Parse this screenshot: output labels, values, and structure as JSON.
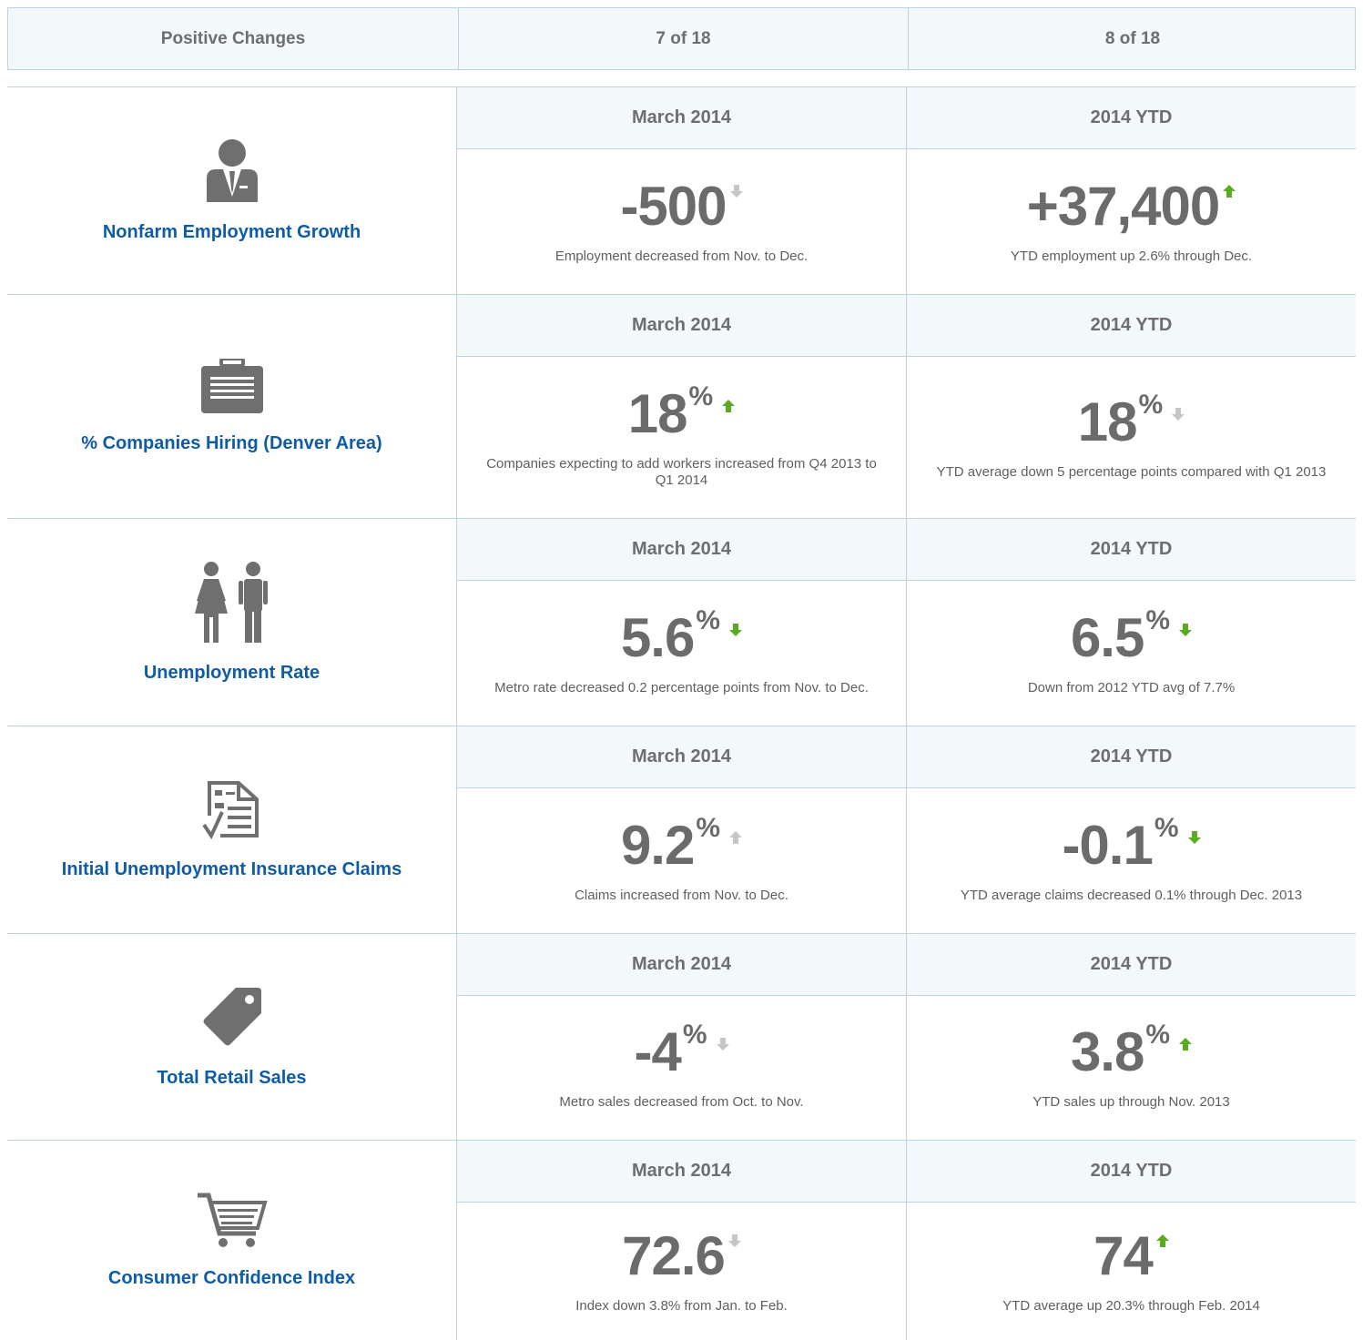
{
  "summary": {
    "label": "Positive Changes",
    "col1": "7 of 18",
    "col2": "8 of 18"
  },
  "colors": {
    "accent_blue": "#0f5ca5",
    "arrow_green": "#5aab22",
    "arrow_gray": "#c6c6c6",
    "border": "#bdd3e2",
    "header_bg": "#f3f8fb"
  },
  "metrics": [
    {
      "title": "Nonfarm Employment Growth",
      "icon": "businessman-icon",
      "col1": {
        "head": "March 2014",
        "value": "-500",
        "unit": "",
        "trend": "down",
        "arrow_color": "gray",
        "desc": "Employment decreased from Nov. to Dec."
      },
      "col2": {
        "head": "2014 YTD",
        "value": "+37,400",
        "unit": "",
        "trend": "up",
        "arrow_color": "green",
        "desc": "YTD employment up 2.6% through Dec."
      }
    },
    {
      "title": "% Companies Hiring (Denver Area)",
      "icon": "briefcase-icon",
      "col1": {
        "head": "March 2014",
        "value": "18",
        "unit": "%",
        "trend": "up",
        "arrow_color": "green",
        "desc": "Companies expecting to add workers increased from Q4 2013 to Q1 2014"
      },
      "col2": {
        "head": "2014 YTD",
        "value": "18",
        "unit": "%",
        "trend": "down",
        "arrow_color": "gray",
        "desc": "YTD average down 5 percentage points compared with Q1 2013"
      }
    },
    {
      "title": "Unemployment Rate",
      "icon": "people-icon",
      "col1": {
        "head": "March 2014",
        "value": "5.6",
        "unit": "%",
        "trend": "down",
        "arrow_color": "green",
        "desc": "Metro rate decreased 0.2 percentage points from Nov. to Dec."
      },
      "col2": {
        "head": "2014 YTD",
        "value": "6.5",
        "unit": "%",
        "trend": "down",
        "arrow_color": "green",
        "desc": "Down from 2012 YTD avg of 7.7%"
      }
    },
    {
      "title": "Initial Unemployment Insurance Claims",
      "icon": "claim-form-icon",
      "col1": {
        "head": "March 2014",
        "value": "9.2",
        "unit": "%",
        "trend": "up",
        "arrow_color": "gray",
        "desc": "Claims increased from Nov. to Dec."
      },
      "col2": {
        "head": "2014 YTD",
        "value": "-0.1",
        "unit": "%",
        "trend": "down",
        "arrow_color": "green",
        "desc": "YTD average claims decreased 0.1% through Dec. 2013"
      }
    },
    {
      "title": "Total Retail Sales",
      "icon": "price-tag-icon",
      "col1": {
        "head": "March 2014",
        "value": "-4",
        "unit": "%",
        "trend": "down",
        "arrow_color": "gray",
        "desc": "Metro sales decreased from Oct. to Nov."
      },
      "col2": {
        "head": "2014 YTD",
        "value": "3.8",
        "unit": "%",
        "trend": "up",
        "arrow_color": "green",
        "desc": "YTD sales up through Nov. 2013"
      }
    },
    {
      "title": "Consumer Confidence Index",
      "icon": "shopping-cart-icon",
      "col1": {
        "head": "March 2014",
        "value": "72.6",
        "unit": "",
        "trend": "down",
        "arrow_color": "gray",
        "desc": "Index down 3.8% from Jan. to Feb."
      },
      "col2": {
        "head": "2014 YTD",
        "value": "74",
        "unit": "",
        "trend": "up",
        "arrow_color": "green",
        "desc": "YTD average up 20.3% through Feb. 2014"
      }
    }
  ]
}
